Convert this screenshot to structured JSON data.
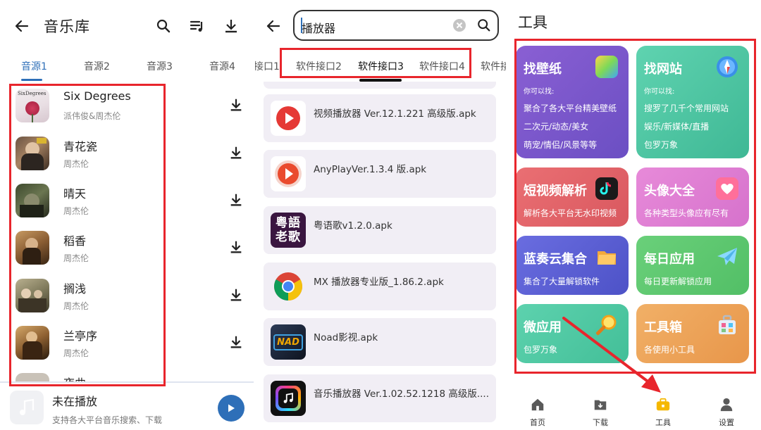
{
  "music_library": {
    "title": "音乐库",
    "tabs": [
      "音源1",
      "音源2",
      "音源3",
      "音源4"
    ],
    "songs": [
      {
        "name": "Six Degrees",
        "artist": "派伟俊&周杰伦",
        "cover_text": "SixDegrees"
      },
      {
        "name": "青花瓷",
        "artist": "周杰伦"
      },
      {
        "name": "晴天",
        "artist": "周杰伦"
      },
      {
        "name": "稻香",
        "artist": "周杰伦"
      },
      {
        "name": "搁浅",
        "artist": "周杰伦"
      },
      {
        "name": "兰亭序",
        "artist": "周杰伦"
      },
      {
        "name": "夜曲",
        "artist": ""
      }
    ],
    "player": {
      "title": "未在播放",
      "subtitle": "支持各大平台音乐搜索、下载"
    }
  },
  "search_page": {
    "query": "播放器",
    "tabs": [
      "接口1",
      "软件接口2",
      "软件接口3",
      "软件接口4",
      "软件接"
    ],
    "active_tab": "软件接口3",
    "files": [
      "视频播放器 Ver.12.1.221 高级版.apk",
      "AnyPlayVer.1.3.4 版.apk",
      "粤语歌v1.2.0.apk",
      "MX 播放器专业版_1.86.2.apk",
      "Noad影视.apk",
      "音乐播放器 Ver.1.02.52.1218 高级版...."
    ],
    "file_icon_texts": {
      "cantonese": "粤語老歌",
      "noad": "NAD"
    }
  },
  "tools_page": {
    "title": "工具",
    "cards": [
      {
        "title": "找壁纸",
        "lines": [
          "你可以找:",
          "聚合了各大平台精美壁纸",
          "二次元/动态/美女",
          "萌宠/情侣/风景等等"
        ],
        "color": "#7b57c9",
        "icon": "wallpaper-icon"
      },
      {
        "title": "找网站",
        "lines": [
          "你可以找:",
          "搜罗了几千个常用网站",
          "娱乐/新媒体/直播",
          "包罗万象"
        ],
        "color": "#4fc7a4",
        "icon": "compass-icon"
      },
      {
        "title": "短视频解析",
        "lines": [
          "解析各大平台无水印视频"
        ],
        "color": "#e0656b",
        "icon": "tiktok-icon"
      },
      {
        "title": "头像大全",
        "lines": [
          "各种类型头像应有尽有"
        ],
        "color": "#db7ed3",
        "icon": "heart-photo-icon"
      },
      {
        "title": "蓝奏云集合",
        "lines": [
          "集合了大量解锁软件"
        ],
        "color": "#5b5fd4",
        "icon": "folder-icon"
      },
      {
        "title": "每日应用",
        "lines": [
          "每日更新解锁应用"
        ],
        "color": "#5cc36f",
        "icon": "paper-plane-icon"
      },
      {
        "title": "微应用",
        "lines": [
          "包罗万象"
        ],
        "color": "#4dc7a3",
        "icon": "magnifier-icon"
      },
      {
        "title": "工具箱",
        "lines": [
          "各使用小工具"
        ],
        "color": "#eda75a",
        "icon": "toolbox-icon"
      }
    ],
    "nav": [
      {
        "label": "首页",
        "icon": "home-icon"
      },
      {
        "label": "下载",
        "icon": "download-folder-icon"
      },
      {
        "label": "工具",
        "icon": "tools-icon",
        "active": true
      },
      {
        "label": "设置",
        "icon": "person-icon"
      }
    ]
  },
  "colors": {
    "accent_blue": "#2e6fb8",
    "highlight_red": "#e8252c",
    "tools_active": "#f5b800"
  }
}
